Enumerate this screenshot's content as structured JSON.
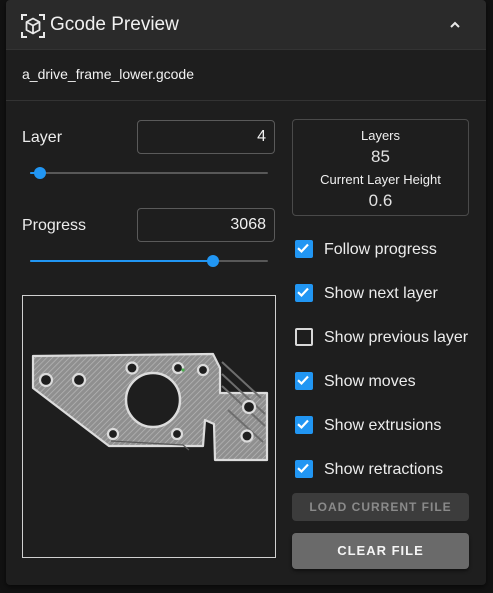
{
  "header": {
    "title": "Gcode Preview",
    "logo_icon": "cube-icon",
    "collapse_icon": "chevron-up-icon"
  },
  "file": {
    "name": "a_drive_frame_lower.gcode"
  },
  "layer": {
    "label": "Layer",
    "value": "4",
    "slider_fraction": 0.04
  },
  "progress": {
    "label": "Progress",
    "value": "3068",
    "slider_fraction": 0.77
  },
  "info": {
    "layers_label": "Layers",
    "layers_value": "85",
    "height_label": "Current Layer Height",
    "height_value": "0.6"
  },
  "options": [
    {
      "label": "Follow progress",
      "checked": true
    },
    {
      "label": "Show next layer",
      "checked": true
    },
    {
      "label": "Show previous layer",
      "checked": false
    },
    {
      "label": "Show moves",
      "checked": true
    },
    {
      "label": "Show extrusions",
      "checked": true
    },
    {
      "label": "Show retractions",
      "checked": true
    }
  ],
  "buttons": {
    "load": "LOAD CURRENT FILE",
    "clear": "CLEAR FILE"
  },
  "colors": {
    "accent": "#2196f3",
    "panel": "#1e1e1e",
    "header": "#2a2a2a"
  }
}
